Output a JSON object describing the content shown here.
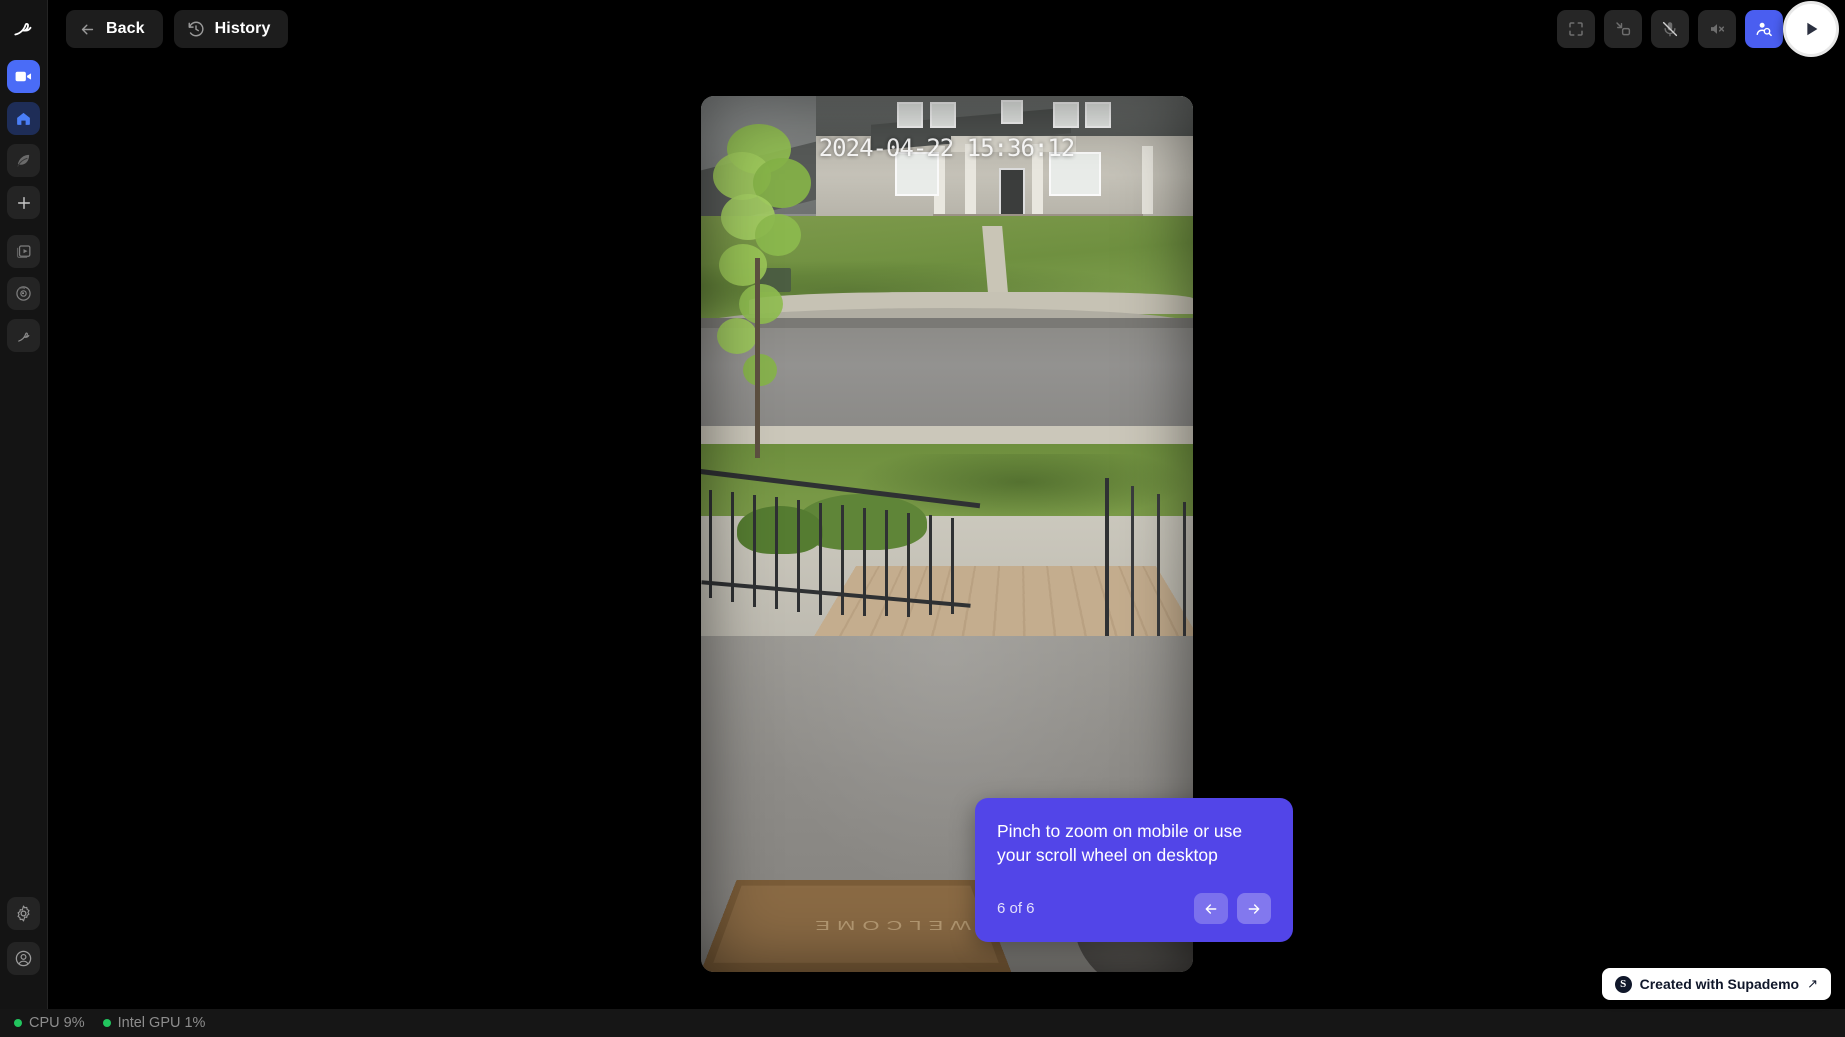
{
  "app": {
    "logo_icon": "bird-logo-icon"
  },
  "sidebar": {
    "items": [
      {
        "name": "cameras",
        "icon": "video-camera-icon",
        "state": "active"
      },
      {
        "name": "home",
        "icon": "home-icon",
        "state": "selected"
      },
      {
        "name": "nature",
        "icon": "leaf-icon",
        "state": "default"
      },
      {
        "name": "add",
        "icon": "plus-icon",
        "state": "default"
      },
      {
        "name": "clips",
        "icon": "media-library-icon",
        "state": "default"
      },
      {
        "name": "radar",
        "icon": "disc-radar-icon",
        "state": "default"
      },
      {
        "name": "brand",
        "icon": "bird-branch-icon",
        "state": "default"
      }
    ],
    "bottom_items": [
      {
        "name": "settings",
        "icon": "gear-icon"
      },
      {
        "name": "account",
        "icon": "user-circle-icon"
      }
    ]
  },
  "header": {
    "back_label": "Back",
    "back_icon": "arrow-left-icon",
    "history_label": "History",
    "history_icon": "history-clock-icon",
    "tools": [
      {
        "name": "fullscreen",
        "icon": "fullscreen-icon",
        "accent": false
      },
      {
        "name": "picture-in-picture",
        "icon": "pip-collapse-icon",
        "accent": false
      },
      {
        "name": "microphone-off",
        "icon": "microphone-off-icon",
        "accent": false
      },
      {
        "name": "speaker-mute",
        "icon": "speaker-mute-icon",
        "accent": false
      },
      {
        "name": "person-search",
        "icon": "person-search-icon",
        "accent": true
      },
      {
        "name": "record-video",
        "icon": "video-record-icon",
        "accent": true
      }
    ],
    "play_icon": "play-icon"
  },
  "video": {
    "timestamp": "2024-04-22 15:36:12",
    "doormat_text": "WELCOME"
  },
  "tooltip": {
    "text": "Pinch to zoom on mobile or use your scroll wheel on desktop",
    "counter": "6 of 6",
    "prev_icon": "arrow-left-icon",
    "next_icon": "arrow-right-icon"
  },
  "statusbar": {
    "items": [
      {
        "label": "CPU 9%",
        "status_color": "#22c55e"
      },
      {
        "label": "Intel GPU 1%",
        "status_color": "#22c55e"
      }
    ]
  },
  "badge": {
    "logo_letter": "S",
    "label": "Created with Supademo",
    "arrow": "↗"
  },
  "colors": {
    "accent_blue": "#4a5ef0",
    "tooltip_purple": "#5245e8",
    "status_green": "#22c55e",
    "background": "#000000",
    "sidebar": "#141414"
  }
}
